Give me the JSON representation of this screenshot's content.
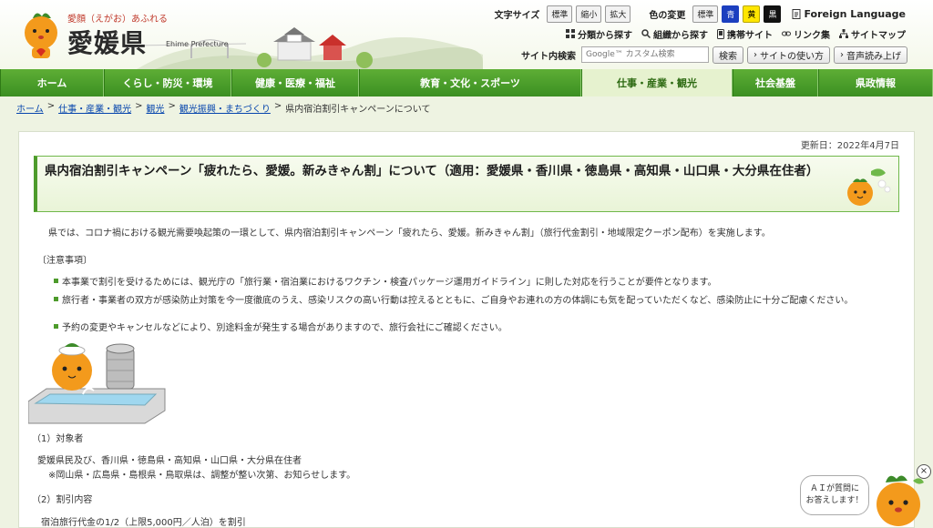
{
  "header": {
    "logo_tagline": "愛顔（えがお）あふれる",
    "logo_name": "愛媛県",
    "logo_sub": "Ehime Prefecture",
    "font_size_label": "文字サイズ",
    "font_sizes": [
      "標準",
      "縮小",
      "拡大"
    ],
    "color_label": "色の変更",
    "colors": [
      "標準",
      "青",
      "黄",
      "黒"
    ],
    "foreign_language": "Foreign Language",
    "links": [
      "分類から探す",
      "組織から探す",
      "携帯サイト",
      "リンク集",
      "サイトマップ"
    ],
    "search_label": "サイト内検索",
    "search_placeholder": "Google™ カスタム検索",
    "search_button": "検索",
    "howto_button": "サイトの使い方",
    "voice_button": "音声読み上げ"
  },
  "nav": {
    "items": [
      "ホーム",
      "くらし・防災・環境",
      "健康・医療・福祉",
      "教育・文化・スポーツ",
      "仕事・産業・観光",
      "社会基盤",
      "県政情報"
    ],
    "active_index": 4
  },
  "breadcrumb": {
    "links": [
      "ホーム",
      "仕事・産業・観光",
      "観光",
      "観光振興・まちづくり"
    ],
    "separator": ">",
    "current": "県内宿泊割引キャンペーンについて"
  },
  "page": {
    "updated": "更新日：2022年4月7日",
    "title": "県内宿泊割引キャンペーン「疲れたら、愛媛。新みきゃん割」について（適用：愛媛県・香川県・徳島県・高知県・山口県・大分県在住者）",
    "intro": "県では、コロナ禍における観光需要喚起策の一環として、県内宿泊割引キャンペーン「疲れたら、愛媛。新みきゃん割」（旅行代金割引・地域限定クーポン配布）を実施します。",
    "notes_heading": "〔注意事項〕",
    "notes": [
      "本事業で割引を受けるためには、観光庁の「旅行業・宿泊業におけるワクチン・検査パッケージ運用ガイドライン」に則した対応を行うことが要件となります。",
      "旅行者・事業者の双方が感染防止対策を今一度徹底のうえ、感染リスクの高い行動は控えるとともに、ご自身やお連れの方の体調にも気を配っていただくなど、感染防止に十分ご配慮ください。",
      "予約の変更やキャンセルなどにより、別途料金が発生する場合がありますので、旅行会社にご確認ください。"
    ],
    "section1_heading": "（1）対象者",
    "section1_line1": "愛媛県民及び、香川県・徳島県・高知県・山口県・大分県在住者",
    "section1_line2": "※岡山県・広島県・島根県・鳥取県は、調整が整い次第、お知らせします。",
    "section2_heading": "（2）割引内容",
    "section2_line1": "宿泊旅行代金の1/2（上限5,000円／人泊）を割引"
  },
  "ai_widget": {
    "line1": "ＡＩが質問に",
    "line2": "お答えします！",
    "close": "×"
  },
  "colors": {
    "nav_green": "#4a9e2b",
    "nav_active_bg": "#e6f2cf",
    "link_blue": "#0645ad",
    "accent_orange": "#f39a1c"
  }
}
